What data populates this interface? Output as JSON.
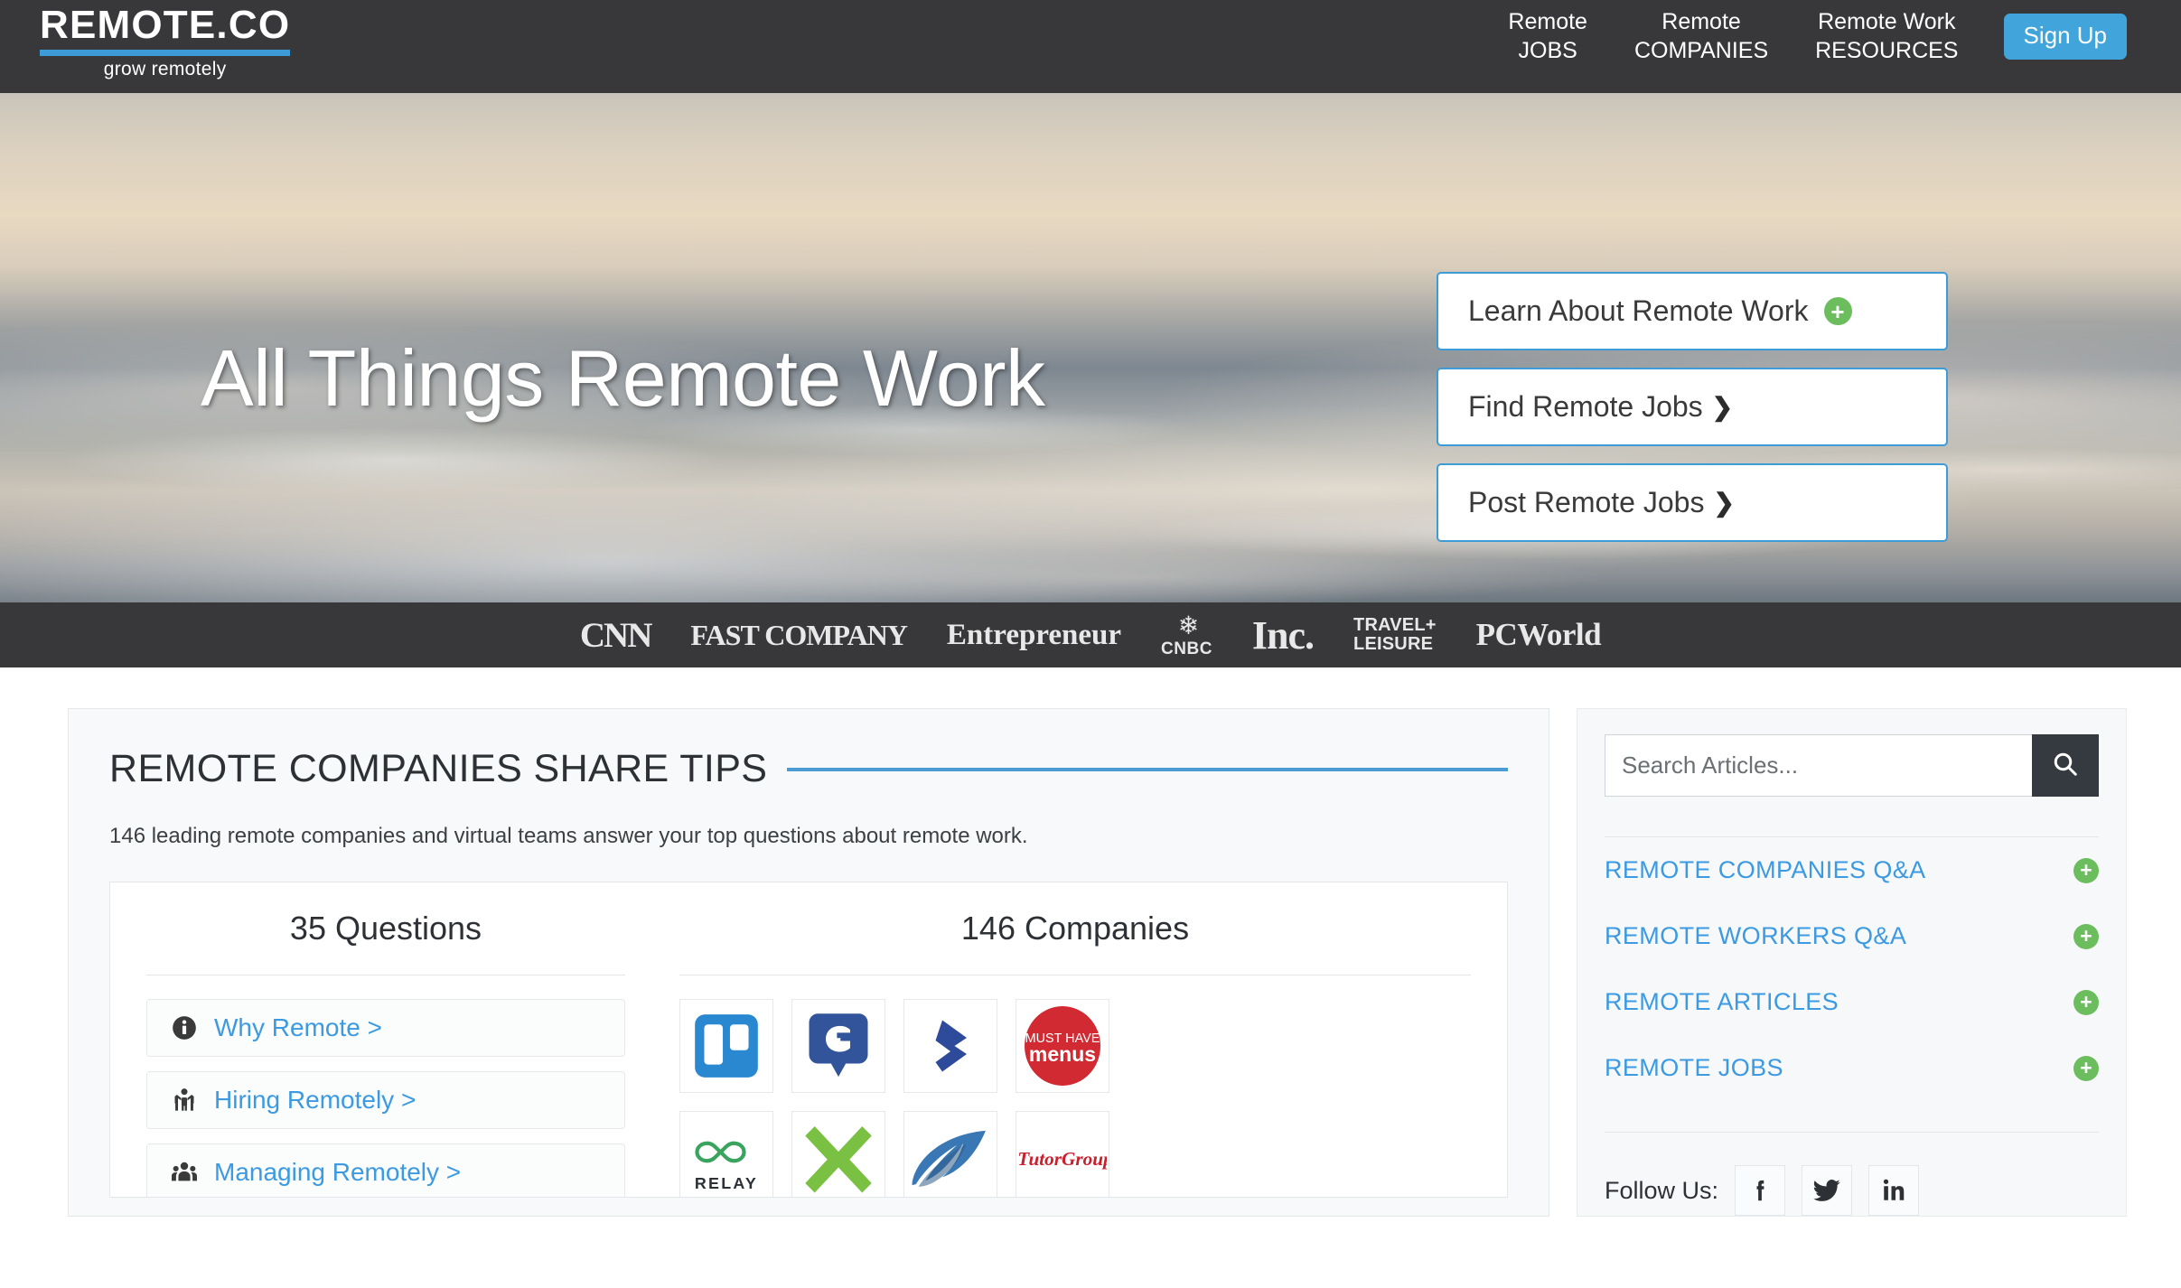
{
  "header": {
    "logo_word": "REMOTE.CO",
    "logo_tagline": "grow remotely",
    "nav": [
      {
        "line1": "Remote",
        "line2": "JOBS"
      },
      {
        "line1": "Remote",
        "line2": "COMPANIES"
      },
      {
        "line1": "Remote Work",
        "line2": "RESOURCES"
      }
    ],
    "signup_label": "Sign Up",
    "accent_blue": "#41a5dc",
    "bar_color": "#38383a"
  },
  "hero": {
    "title": "All Things Remote Work",
    "ctas": [
      {
        "label": "Learn About Remote Work",
        "icon": "plus-circle-icon",
        "icon_glyph": "+"
      },
      {
        "label": "Find Remote Jobs",
        "icon": "chevron-right-icon",
        "icon_glyph": "❯"
      },
      {
        "label": "Post Remote Jobs",
        "icon": "chevron-right-icon",
        "icon_glyph": "❯"
      }
    ],
    "border_blue": "#3d9bd8",
    "plus_green": "#6cbd5e"
  },
  "press": {
    "logos": [
      "CNN",
      "FAST COMPANY",
      "Entrepreneur",
      "CNBC",
      "Inc.",
      "TRAVEL+ LEISURE",
      "PCWorld"
    ],
    "travel_line1": "TRAVEL+",
    "travel_line2": "LEISURE",
    "cnbc_text": "CNBC",
    "cnn_text": "CNN",
    "fast_text": "FAST COMPANY",
    "ent_text": "Entrepreneur",
    "inc_text": "Inc.",
    "pcw_text": "PCWorld"
  },
  "main": {
    "section_title": "REMOTE COMPANIES SHARE TIPS",
    "section_rule_color": "#4a9cd3",
    "section_subtitle": "146 leading remote companies and virtual teams answer your top questions about remote work.",
    "questions_heading": "35 Questions",
    "companies_heading": "146 Companies",
    "questions": [
      {
        "label": "Why Remote >",
        "icon": "info-circle-icon"
      },
      {
        "label": "Hiring Remotely >",
        "icon": "person-raised-arms-icon"
      },
      {
        "label": "Managing Remotely >",
        "icon": "people-group-icon"
      }
    ],
    "company_logos": [
      {
        "name": "trello-logo",
        "alt": "Trello"
      },
      {
        "name": "clarity-logo",
        "alt": "C"
      },
      {
        "name": "arrow-logo",
        "alt": "Arrow"
      },
      {
        "name": "must-have-menus-logo",
        "alt": "MUST HAVE menus",
        "line1": "MUST HAVE",
        "line2": "menus"
      },
      {
        "name": "relay-logo",
        "alt": "RELAY",
        "line1": "RELAY"
      },
      {
        "name": "green-x-logo",
        "alt": "X"
      },
      {
        "name": "blue-feather-logo",
        "alt": "Feather"
      },
      {
        "name": "itutorgroup-logo",
        "alt": "iTutorGroup",
        "line1": "iTutorGroup"
      }
    ]
  },
  "sidebar": {
    "search_placeholder": "Search Articles...",
    "search_value": "",
    "search_icon": "search-icon",
    "links": [
      {
        "label": "REMOTE COMPANIES Q&A",
        "icon": "plus-circle-icon",
        "glyph": "+"
      },
      {
        "label": "REMOTE WORKERS Q&A",
        "icon": "plus-circle-icon",
        "glyph": "+"
      },
      {
        "label": "REMOTE ARTICLES",
        "icon": "plus-circle-icon",
        "glyph": "+"
      },
      {
        "label": "REMOTE JOBS",
        "icon": "plus-circle-icon",
        "glyph": "+"
      }
    ],
    "follow_label": "Follow Us:",
    "socials": [
      {
        "name": "facebook-icon",
        "glyph": "f"
      },
      {
        "name": "twitter-icon",
        "glyph": "t"
      },
      {
        "name": "linkedin-icon",
        "glyph": "in"
      }
    ],
    "link_blue": "#3b9ae1"
  }
}
